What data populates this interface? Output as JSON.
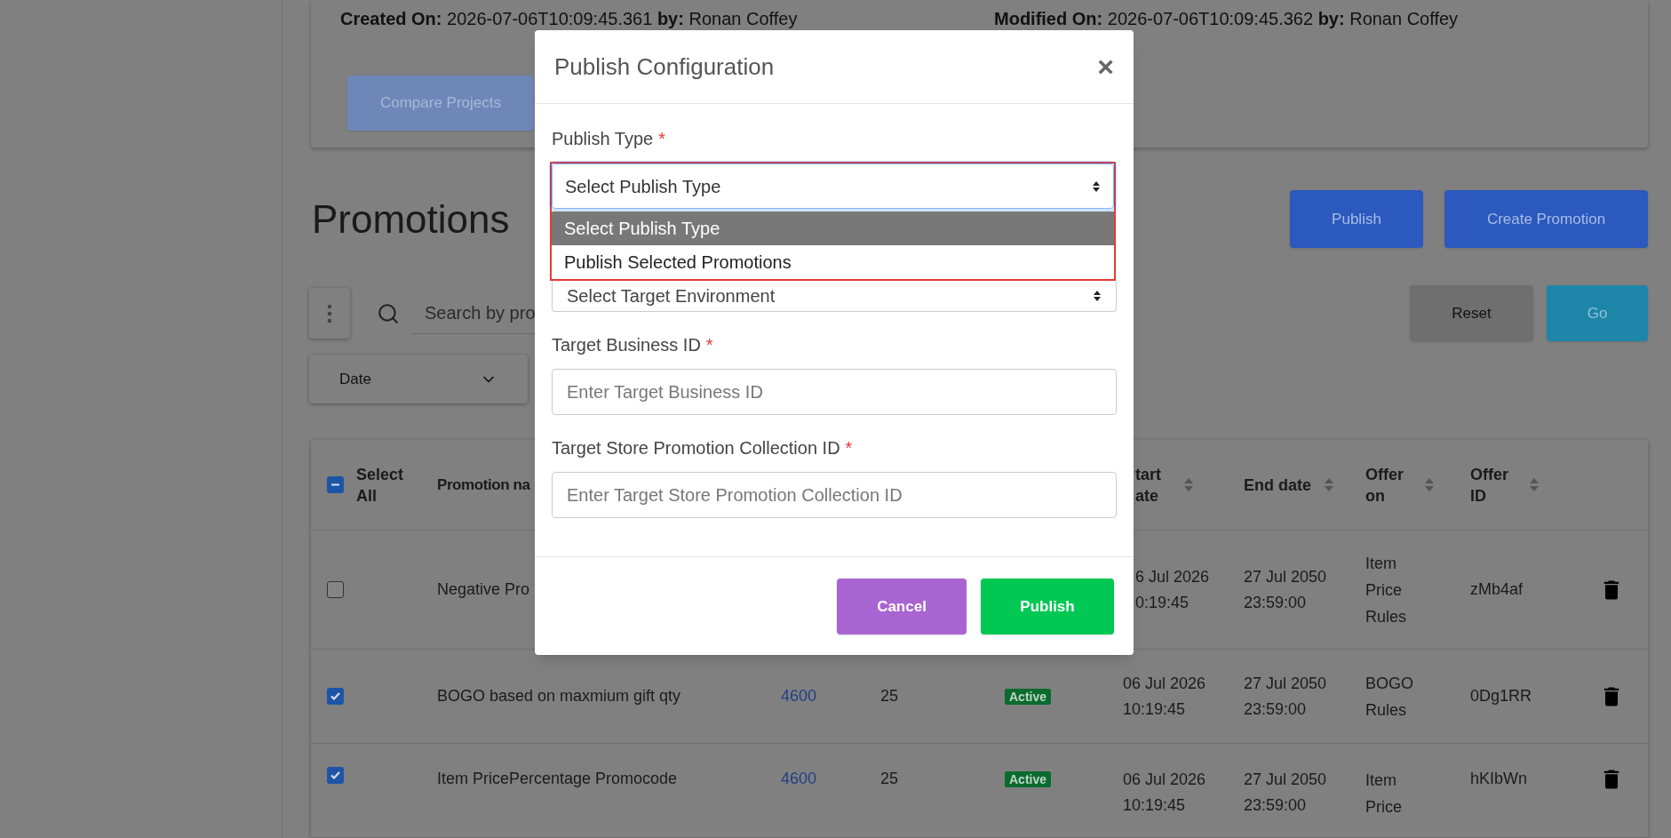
{
  "record": {
    "created": "**Created On:** 2026-07-06T10:09:45.361 **by:** Ronan Coffey",
    "modified": "**Modified On:** 2026-07-06T10:09:45.362 **by:** Ronan Coffey",
    "compare_button": "Compare Projects"
  },
  "heading": "Promotions",
  "header_buttons": [
    "Publish",
    "Create Promotion"
  ],
  "search": {
    "placeholder": "Search by pro"
  },
  "filter_buttons": [
    "Reset",
    "Go"
  ],
  "date_filter": "Date",
  "table": {
    "select_all": {
      "label": "Select All",
      "indeterminate": true
    },
    "columns": [
      {
        "label": "Promotion na"
      },
      {
        "label": "tart ate",
        "sortable": true
      },
      {
        "label": "End date",
        "sortable": true
      },
      {
        "label": "Offer on",
        "sortable": true
      },
      {
        "label": "Offer ID",
        "sortable": true
      }
    ],
    "rows": [
      {
        "checked": false,
        "name": "Negative Pro",
        "start_date": "6 Jul 2026",
        "start_time": "0:19:45",
        "end_date": "27 Jul 2050",
        "end_time": "23:59:00",
        "offer_on": "Item Price Rules",
        "offer_id": "zMb4af"
      },
      {
        "checked": true,
        "name": "BOGO based on maxmium gift qty",
        "link": "4600",
        "qty": "25",
        "status": "Active",
        "start_date": "06 Jul 2026",
        "start_time": "10:19:45",
        "end_date": "27 Jul 2050",
        "end_time": "23:59:00",
        "offer_on": "BOGO Rules",
        "offer_id": "0Dg1RR"
      },
      {
        "checked": true,
        "name": "Item PricePercentage Promocode",
        "link": "4600",
        "qty": "25",
        "status": "Active",
        "start_date": "06 Jul 2026",
        "start_time": "10:19:45",
        "end_date": "27 Jul 2050",
        "end_time": "23:59:00",
        "offer_on": "Item Price",
        "offer_id": "hKIbWn"
      }
    ]
  },
  "modal": {
    "title": "Publish Configuration",
    "close": "×",
    "required_mark": "*",
    "publish_type": {
      "label": "Publish Type",
      "required": true,
      "value": "Select Publish Type",
      "options": [
        {
          "label": "Select Publish Type",
          "selected": true
        },
        {
          "label": "Publish Selected Promotions",
          "selected": false
        }
      ]
    },
    "environment": {
      "value": "Select Target Environment"
    },
    "fields": [
      {
        "label": "Target Business ID",
        "required": true,
        "placeholder": "Enter Target Business ID"
      },
      {
        "label": "Target Store Promotion Collection ID",
        "required": true,
        "placeholder": "Enter Target Store Promotion Collection ID"
      }
    ],
    "buttons": [
      {
        "label": "Cancel",
        "kind": "secondary"
      },
      {
        "label": "Publish",
        "kind": "primary"
      }
    ]
  }
}
